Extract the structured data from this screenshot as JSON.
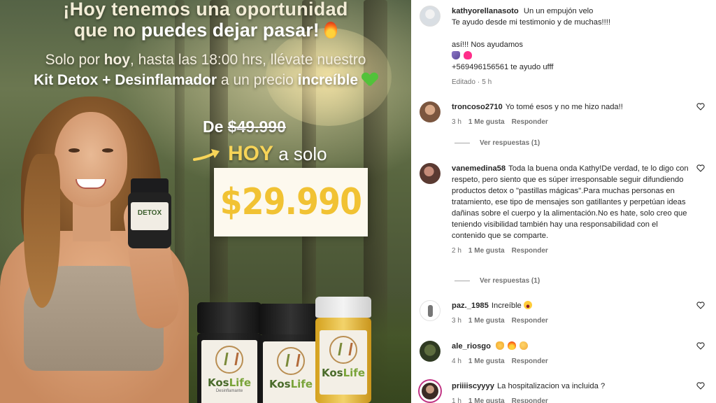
{
  "promo": {
    "headline_line1": "¡Hoy tenemos una oportunidad",
    "headline_line2_pre": "que no ",
    "headline_line2_bold": "puedes dejar pasar!",
    "sub_line1_pre": "Solo por ",
    "sub_line1_bold": "hoy",
    "sub_line1_post": ", hasta las 18:00 hrs, llévate nuestro",
    "sub_line2_bold": "Kit Detox + Desinflamador",
    "sub_line2_mid": " a un precio ",
    "sub_line2_bold2": "increíble",
    "was_prefix": "De ",
    "was_price": "$49.990",
    "today_hoy": "HOY",
    "today_rest": " a solo",
    "price": "$29.990",
    "small_bottle_label": "DETOX",
    "jar_brand_a": "Kos",
    "jar_brand_b": "Life",
    "jar1_sub": "Desinflamante",
    "jar2_sub": "",
    "jar3_sub": ""
  },
  "comments": [
    {
      "username": "kathyorellanasoto",
      "text_line1": "Un un empujón velo",
      "text_line2": "Te ayudo desde mi testimonio y de muchas!!!!",
      "text_line3": "así!!! Nos ayudamos",
      "text_line4": "+569496156561 te ayudo ufff",
      "meta_edited": "Editado",
      "meta_sep": "·",
      "meta_time": "5 h"
    },
    {
      "username": "troncoso2710",
      "text": "Yo tomé esos y no me hizo nada!!",
      "time": "3 h",
      "likes": "1 Me gusta",
      "reply": "Responder",
      "view_replies": "Ver respuestas (1)"
    },
    {
      "username": "vanemedina58",
      "text": "Toda la buena onda Kathy!De verdad, te lo digo con respeto, pero siento que es súper irresponsable seguir difundiendo productos detox o \"pastillas mágicas\".Para muchas personas en tratamiento, ese tipo de mensajes son gatillantes y perpetúan ideas dañinas sobre el cuerpo y la alimentación.No es hate, solo creo que teniendo visibilidad también hay una responsabilidad con el contenido que se comparte.",
      "time": "2 h",
      "likes": "1 Me gusta",
      "reply": "Responder",
      "view_replies": "Ver respuestas (1)"
    },
    {
      "username": "paz._1985",
      "text": "Increíble",
      "time": "3 h",
      "likes": "1 Me gusta",
      "reply": "Responder"
    },
    {
      "username": "ale_riosgo",
      "text": "",
      "time": "4 h",
      "likes": "1 Me gusta",
      "reply": "Responder"
    },
    {
      "username": "priiiiscyyyy",
      "text": "La hospitalizacion va incluida ?",
      "time": "1 h",
      "likes": "1 Me gusta",
      "reply": "Responder"
    }
  ],
  "icons": {
    "like": "heart-outline-icon",
    "accent": "#c13584"
  }
}
